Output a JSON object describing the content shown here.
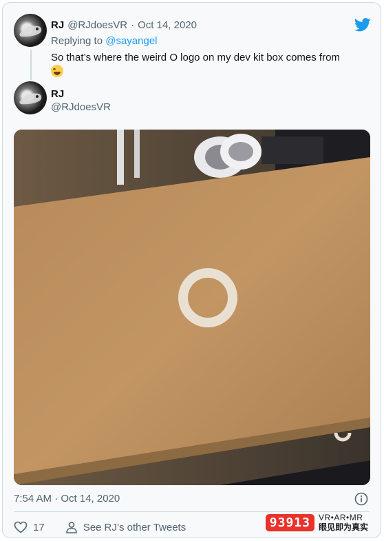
{
  "colors": {
    "accent": "#1d9bf0",
    "muted": "#536471",
    "watermark_red": "#e8322b"
  },
  "reply": {
    "name": "RJ",
    "handle": "@RJdoesVR",
    "separator": "·",
    "date": "Oct 14, 2020",
    "replying_prefix": "Replying to",
    "replying_handle": "@sayangel",
    "text": "So that’s where the weird O logo on my dev kit box comes from",
    "emoji": "face-with-tears-of-joy-icon"
  },
  "quoted": {
    "name": "RJ",
    "handle": "@RJdoesVR"
  },
  "footer": {
    "timestamp": "7:54 AM · Oct 14, 2020",
    "likes": "17",
    "see_other": "See RJ’s other Tweets"
  },
  "watermark": {
    "logo": "93913",
    "top": "VR•AR•MR",
    "bottom": "眼见即为真实"
  }
}
